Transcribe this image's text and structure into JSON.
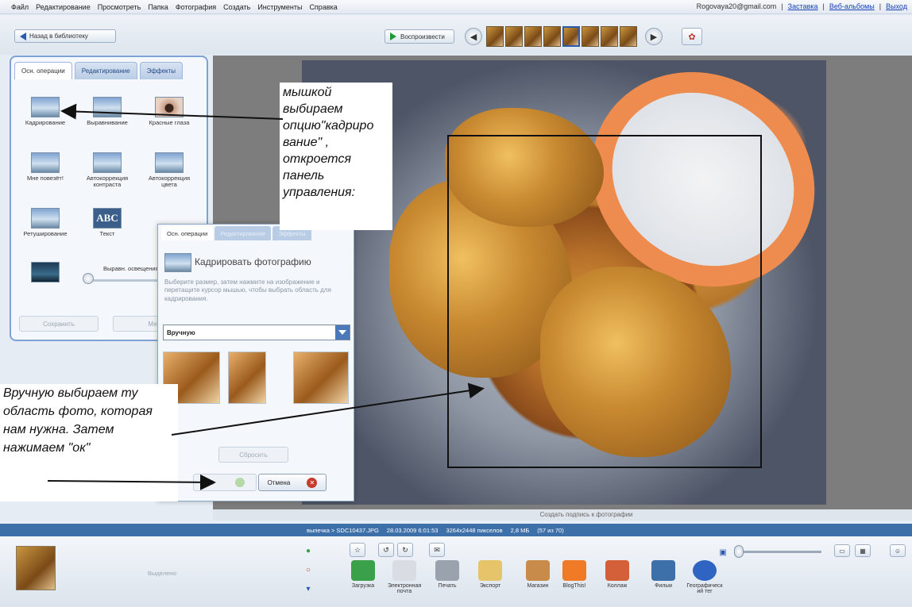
{
  "menu": {
    "items": [
      "Файл",
      "Редактирование",
      "Просмотреть",
      "Папка",
      "Фотография",
      "Создать",
      "Инструменты",
      "Справка"
    ],
    "account": "Rogovaya20@gmail.com",
    "sep": "|",
    "link_screensaver": "Заставка",
    "link_webalbums": "Веб-альбомы",
    "link_exit": "Выход"
  },
  "toolbar": {
    "back_label": "Назад в библиотеку",
    "play_label": "Воспроизвести",
    "prev_icon": "arrow-left-icon",
    "next_icon": "arrow-right-icon",
    "filmstrip_count": 8
  },
  "left_panel": {
    "tabs": [
      "Осн. операции",
      "Редактирование",
      "Эффекты"
    ],
    "tools": [
      {
        "label": "Кадрирование",
        "icon": "crop-icon"
      },
      {
        "label": "Выравнивание",
        "icon": "straighten-icon"
      },
      {
        "label": "Красные глаза",
        "icon": "red-eye-icon"
      },
      {
        "label": "Мне повезёт!",
        "icon": "im-feeling-lucky-icon"
      },
      {
        "label": "Автокоррекция контраста",
        "icon": "auto-contrast-icon"
      },
      {
        "label": "Автокоррекция цвета",
        "icon": "auto-color-icon"
      },
      {
        "label": "Ретуширование",
        "icon": "retouch-icon"
      },
      {
        "label": "Текст",
        "icon": "text-icon",
        "text": "ABC"
      }
    ],
    "fill_light_label": "Выравн. освещения",
    "btn_save": "Сохранить",
    "btn_other": "Ме"
  },
  "crop_panel": {
    "tabs": [
      "Осн. операции",
      "Редактирование",
      "Эффекты"
    ],
    "title": "Кадрировать фотографию",
    "description": "Выберите размер, затем нажмите на изображение и перетащите курсор мышью, чтобы выбрать область для кадрирования.",
    "select_value": "Вручную",
    "btn_reset": "Сбросить",
    "btn_ok": "ОК",
    "btn_cancel": "Отмена"
  },
  "annotations": {
    "note_top": "мышкой выбираем опцию\"кадриро вание\" , откроется панель управления:",
    "note_bottom": "Вручную выбираем ту область фото, которая нам нужна. Затем нажимаем \"ок\""
  },
  "caption_placeholder": "Создать подпись к фотографии",
  "status": {
    "path": "выпечка > SDC10437.JPG",
    "date": "28.03.2009 6:01:53",
    "dims": "3264x2448 пикселов",
    "size": "2,8 МБ",
    "zoom": "(57 из 70)"
  },
  "tray": {
    "label": "Выделено:",
    "actions": [
      {
        "label": "Загрузка",
        "icon": "upload-icon",
        "color": "#3aa04a"
      },
      {
        "label": "Электронная почта",
        "icon": "email-icon",
        "color": "#d9dde3"
      },
      {
        "label": "Печать",
        "icon": "print-icon",
        "color": "#9aa3ad"
      },
      {
        "label": "Экспорт",
        "icon": "folder-icon",
        "color": "#e6c46a"
      },
      {
        "label": "Магазин",
        "icon": "shop-icon",
        "color": "#c98b4a"
      },
      {
        "label": "BlogThis!",
        "icon": "blogger-icon",
        "color": "#f07a25"
      },
      {
        "label": "Коллаж",
        "icon": "collage-icon",
        "color": "#d4603a"
      },
      {
        "label": "Фильм",
        "icon": "movie-icon",
        "color": "#3d6fa8"
      },
      {
        "label": "Географическ ий тег",
        "icon": "geotag-icon",
        "color": "#2f64c2"
      }
    ]
  },
  "colors": {
    "accent": "#3d6fa8",
    "panel_border": "#7fa2d4"
  }
}
